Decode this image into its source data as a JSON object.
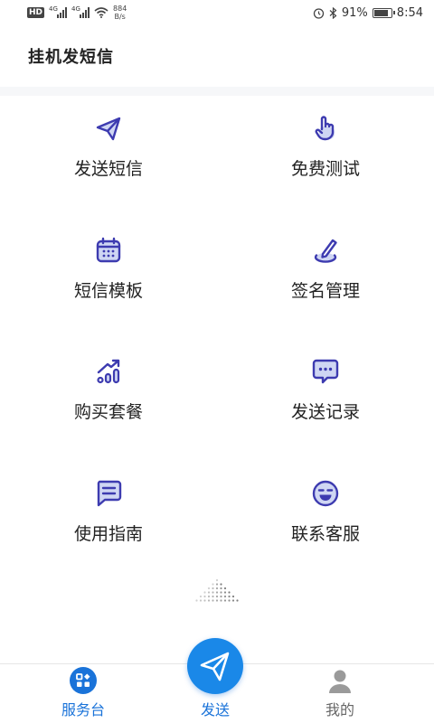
{
  "status_bar": {
    "hd_badge": "HD",
    "sim1_tag": "4G",
    "sim2_tag": "4G",
    "net_speed_value": "884",
    "net_speed_unit": "B/s",
    "battery_percent": "91%",
    "battery_level": 0.91,
    "time": "8:54",
    "icons": [
      "hd-icon",
      "signal-icon",
      "wifi-icon",
      "alarm-icon",
      "bluetooth-icon",
      "battery-icon"
    ]
  },
  "header": {
    "title": "挂机发短信"
  },
  "colors": {
    "accent": "#1a73d9",
    "icon_purple": "#3d3bb0",
    "fab_blue": "#1a88e8"
  },
  "grid": {
    "items": [
      {
        "label": "发送短信",
        "icon": "paper-plane-icon"
      },
      {
        "label": "免费测试",
        "icon": "tap-finger-icon"
      },
      {
        "label": "短信模板",
        "icon": "calendar-icon"
      },
      {
        "label": "签名管理",
        "icon": "signature-pen-icon"
      },
      {
        "label": "购买套餐",
        "icon": "growth-chart-icon"
      },
      {
        "label": "发送记录",
        "icon": "chat-dots-icon"
      },
      {
        "label": "使用指南",
        "icon": "message-lines-icon"
      },
      {
        "label": "联系客服",
        "icon": "smile-icon"
      }
    ]
  },
  "tabbar": {
    "tabs": [
      {
        "label": "服务台",
        "icon": "service-desk-icon"
      },
      {
        "label": "发送",
        "icon": "paper-plane-icon"
      },
      {
        "label": "我的",
        "icon": "user-icon"
      }
    ]
  }
}
